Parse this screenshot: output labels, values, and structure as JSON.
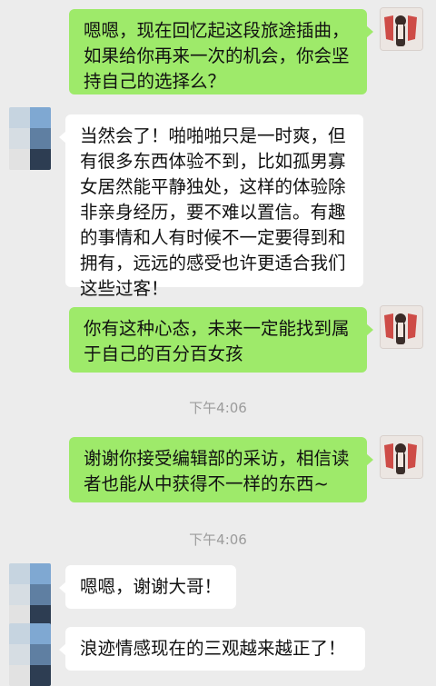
{
  "messages": [
    {
      "side": "right",
      "text": "嗯嗯，现在回忆起这段旅途插曲，\n如果给你再来一次的机会，你会坚\n持自己的选择么？"
    },
    {
      "side": "left",
      "text": "当然会了！啪啪啪只是一时爽，但\n有很多东西体验不到，比如孤男寡\n女居然能平静独处，这样的体验除\n非亲身经历，要不难以置信。有趣\n的事情和人有时候不一定要得到和\n拥有，远远的感受也许更适合我们\n这些过客！"
    },
    {
      "side": "right",
      "text": "你有这种心态，未来一定能找到属\n于自己的百分百女孩"
    },
    {
      "side": "right",
      "text": "谢谢你接受编辑部的采访，相信读\n者也能从中获得不一样的东西~"
    },
    {
      "side": "left",
      "text": "嗯嗯，谢谢大哥！"
    },
    {
      "side": "left",
      "text": "浪迹情感现在的三观越来越正了！"
    }
  ],
  "timestamps": [
    "下午4:06",
    "下午4:06"
  ],
  "colors": {
    "background": "#ececec",
    "outgoing_bubble": "#9eea6a",
    "incoming_bubble": "#ffffff",
    "timestamp": "#9b9b9b"
  },
  "icons": {
    "right_avatar": "girl-photo-avatar",
    "left_avatar": "blurred-pixel-avatar"
  }
}
